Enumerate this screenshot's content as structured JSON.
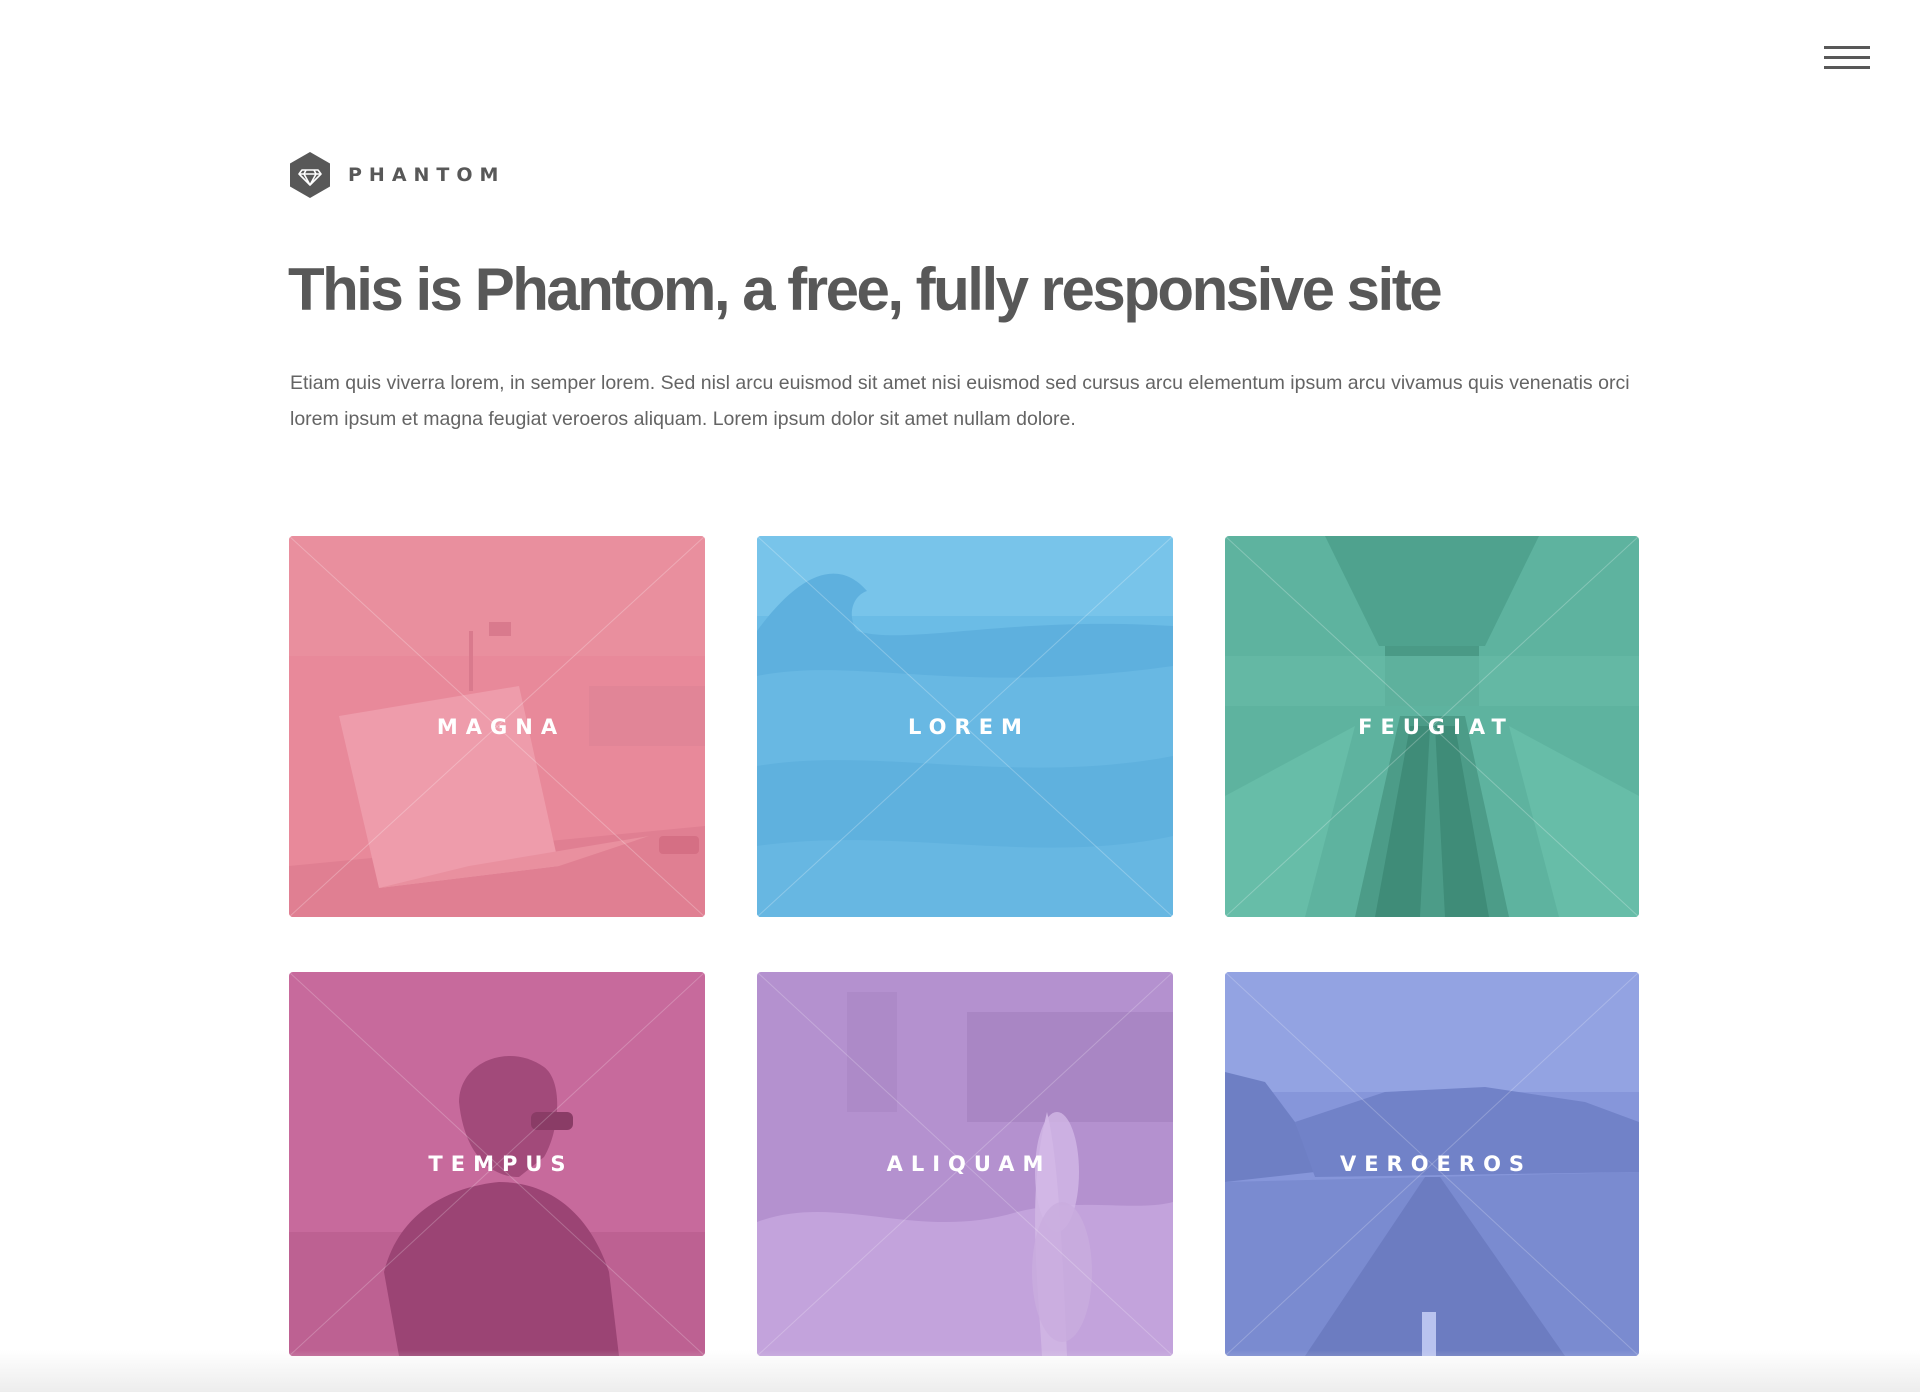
{
  "header": {
    "menu_icon": "hamburger-menu-icon",
    "logo_icon": "diamond-icon",
    "logo_text": "PHANTOM"
  },
  "main": {
    "title": "This is Phantom, a free, fully responsive site",
    "intro": "Etiam quis viverra lorem, in semper lorem. Sed nisl arcu euismod sit amet nisi euismod sed cursus arcu elementum ipsum arcu vivamus quis venenatis orci lorem ipsum et magna feugiat veroeros aliquam. Lorem ipsum dolor sit amet nullam dolore."
  },
  "tiles": [
    {
      "label": "MAGNA",
      "color": "#e8899a",
      "image": "laptop on desk"
    },
    {
      "label": "LOREM",
      "color": "#6bbce6",
      "image": "ocean wave"
    },
    {
      "label": "FEUGIAT",
      "color": "#5eb39f",
      "image": "escalators"
    },
    {
      "label": "TEMPUS",
      "color": "#c76a9c",
      "image": "person with sunglasses"
    },
    {
      "label": "ALIQUAM",
      "color": "#b491cf",
      "image": "plant flowers"
    },
    {
      "label": "VEROEROS",
      "color": "#8696da",
      "image": "road and mountains"
    }
  ]
}
